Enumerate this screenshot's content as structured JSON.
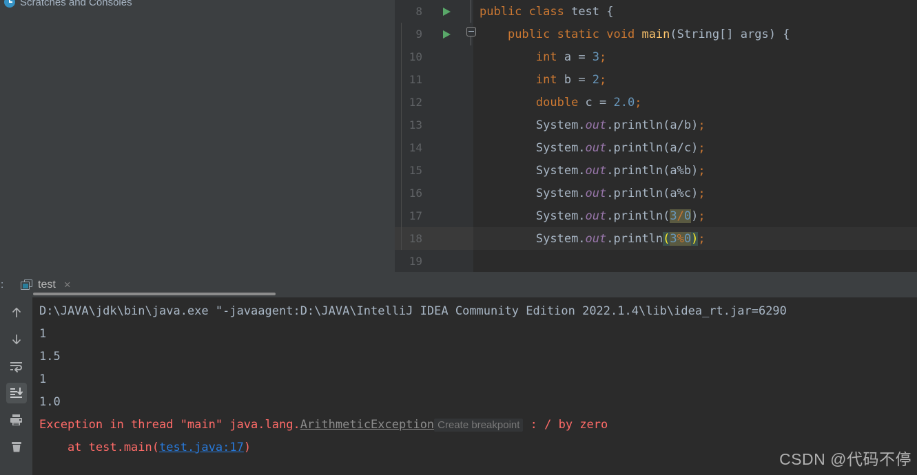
{
  "left_panel": {
    "tree_item": {
      "label": "Scratches and Consoles",
      "icon": "scratches-icon"
    }
  },
  "editor": {
    "lines": [
      {
        "num": "8",
        "indent": 0,
        "run_marker": true,
        "fold": false,
        "bulb": false,
        "current": false,
        "tokens": [
          {
            "t": "public ",
            "c": "kw"
          },
          {
            "t": "class ",
            "c": "kw"
          },
          {
            "t": "test",
            "c": "cls"
          },
          {
            "t": " {",
            "c": "ident"
          }
        ]
      },
      {
        "num": "9",
        "indent": 1,
        "run_marker": true,
        "fold": true,
        "bulb": false,
        "current": false,
        "tokens": [
          {
            "t": "    ",
            "c": "ident"
          },
          {
            "t": "public ",
            "c": "kw"
          },
          {
            "t": "static ",
            "c": "kw"
          },
          {
            "t": "void ",
            "c": "kw"
          },
          {
            "t": "main",
            "c": "mth"
          },
          {
            "t": "(String[] args) {",
            "c": "ident"
          }
        ]
      },
      {
        "num": "10",
        "indent": 2,
        "run_marker": false,
        "fold": false,
        "bulb": false,
        "current": false,
        "tokens": [
          {
            "t": "        ",
            "c": "ident"
          },
          {
            "t": "int ",
            "c": "kw"
          },
          {
            "t": "a = ",
            "c": "ident"
          },
          {
            "t": "3",
            "c": "num"
          },
          {
            "t": ";",
            "c": "sem"
          }
        ]
      },
      {
        "num": "11",
        "indent": 2,
        "run_marker": false,
        "fold": false,
        "bulb": false,
        "current": false,
        "tokens": [
          {
            "t": "        ",
            "c": "ident"
          },
          {
            "t": "int ",
            "c": "kw"
          },
          {
            "t": "b = ",
            "c": "ident"
          },
          {
            "t": "2",
            "c": "num"
          },
          {
            "t": ";",
            "c": "sem"
          }
        ]
      },
      {
        "num": "12",
        "indent": 2,
        "run_marker": false,
        "fold": false,
        "bulb": false,
        "current": false,
        "tokens": [
          {
            "t": "        ",
            "c": "ident"
          },
          {
            "t": "double ",
            "c": "kw"
          },
          {
            "t": "c = ",
            "c": "ident"
          },
          {
            "t": "2.0",
            "c": "num"
          },
          {
            "t": ";",
            "c": "sem"
          }
        ]
      },
      {
        "num": "13",
        "indent": 2,
        "run_marker": false,
        "fold": false,
        "bulb": false,
        "current": false,
        "tokens": [
          {
            "t": "        ",
            "c": "ident"
          },
          {
            "t": "System.",
            "c": "ident"
          },
          {
            "t": "out",
            "c": "fld"
          },
          {
            "t": ".println(a/b)",
            "c": "ident"
          },
          {
            "t": ";",
            "c": "sem"
          }
        ]
      },
      {
        "num": "14",
        "indent": 2,
        "run_marker": false,
        "fold": false,
        "bulb": false,
        "current": false,
        "tokens": [
          {
            "t": "        ",
            "c": "ident"
          },
          {
            "t": "System.",
            "c": "ident"
          },
          {
            "t": "out",
            "c": "fld"
          },
          {
            "t": ".println(a/c)",
            "c": "ident"
          },
          {
            "t": ";",
            "c": "sem"
          }
        ]
      },
      {
        "num": "15",
        "indent": 2,
        "run_marker": false,
        "fold": false,
        "bulb": false,
        "current": false,
        "tokens": [
          {
            "t": "        ",
            "c": "ident"
          },
          {
            "t": "System.",
            "c": "ident"
          },
          {
            "t": "out",
            "c": "fld"
          },
          {
            "t": ".println(a%b)",
            "c": "ident"
          },
          {
            "t": ";",
            "c": "sem"
          }
        ]
      },
      {
        "num": "16",
        "indent": 2,
        "run_marker": false,
        "fold": false,
        "bulb": false,
        "current": false,
        "tokens": [
          {
            "t": "        ",
            "c": "ident"
          },
          {
            "t": "System.",
            "c": "ident"
          },
          {
            "t": "out",
            "c": "fld"
          },
          {
            "t": ".println(a%c)",
            "c": "ident"
          },
          {
            "t": ";",
            "c": "sem"
          }
        ]
      },
      {
        "num": "17",
        "indent": 2,
        "run_marker": false,
        "fold": false,
        "bulb": false,
        "current": false,
        "tokens": [
          {
            "t": "        ",
            "c": "ident"
          },
          {
            "t": "System.",
            "c": "ident"
          },
          {
            "t": "out",
            "c": "fld"
          },
          {
            "t": ".println(",
            "c": "ident"
          },
          {
            "t": "3",
            "c": "num hl-olive"
          },
          {
            "t": "/",
            "c": "sem hl-olive"
          },
          {
            "t": "0",
            "c": "num hl-olive"
          },
          {
            "t": ")",
            "c": "ident"
          },
          {
            "t": ";",
            "c": "sem"
          }
        ]
      },
      {
        "num": "18",
        "indent": 2,
        "run_marker": false,
        "fold": false,
        "bulb": true,
        "current": true,
        "tokens": [
          {
            "t": "        ",
            "c": "ident"
          },
          {
            "t": "System.",
            "c": "ident"
          },
          {
            "t": "out",
            "c": "fld"
          },
          {
            "t": ".println",
            "c": "ident"
          },
          {
            "t": "(",
            "c": "hl-paren"
          },
          {
            "t": "3",
            "c": "num hl-olive"
          },
          {
            "t": "%",
            "c": "sem hl-olive"
          },
          {
            "t": "0",
            "c": "num hl-olive"
          },
          {
            "t": ")",
            "c": "hl-paren"
          },
          {
            "t": ";",
            "c": "sem"
          }
        ]
      },
      {
        "num": "19",
        "indent": 0,
        "run_marker": false,
        "fold": false,
        "bulb": false,
        "current": false,
        "tokens": []
      }
    ]
  },
  "run_window": {
    "colon": ":",
    "tab": {
      "label": "test",
      "icon": "console-tab-icon",
      "close": "×"
    },
    "toolbar": [
      {
        "name": "rerun-up-arrow",
        "icon": "arrow-up-icon",
        "selected": false
      },
      {
        "name": "rerun-down-arrow",
        "icon": "arrow-down-icon",
        "selected": false
      },
      {
        "name": "soft-wrap",
        "icon": "soft-wrap-icon",
        "selected": false
      },
      {
        "name": "scroll-to-end",
        "icon": "scroll-to-end-icon",
        "selected": true
      },
      {
        "name": "print",
        "icon": "printer-icon",
        "selected": false
      },
      {
        "name": "clear-all",
        "icon": "trash-icon",
        "selected": false
      }
    ],
    "console": {
      "command": "D:\\JAVA\\jdk\\bin\\java.exe \"-javaagent:D:\\JAVA\\IntelliJ IDEA Community Edition 2022.1.4\\lib\\idea_rt.jar=6290",
      "outputs": [
        "1",
        "1.5",
        "1",
        "1.0"
      ],
      "exception": {
        "prefix": "Exception in thread \"main\" java.lang.",
        "type": "ArithmeticException",
        "breakpoint_hint": "Create breakpoint",
        "separator": " : ",
        "message": "/ by zero"
      },
      "stack_frame": {
        "prefix": "    at test.main(",
        "link": "test.java:17",
        "suffix": ")"
      }
    }
  },
  "watermark": {
    "text": "CSDN @代码不停"
  },
  "colors": {
    "editor_bg": "#2B2B2B",
    "gutter_bg": "#313335",
    "panel_bg": "#3C3F41",
    "keyword": "#CC7832",
    "number": "#6897BB",
    "method": "#FFC66D",
    "field": "#9876AA",
    "text": "#A9B7C6",
    "error": "#FF6B68",
    "link": "#287BDE",
    "run_green": "#59A869",
    "bulb": "#F2A73B"
  }
}
